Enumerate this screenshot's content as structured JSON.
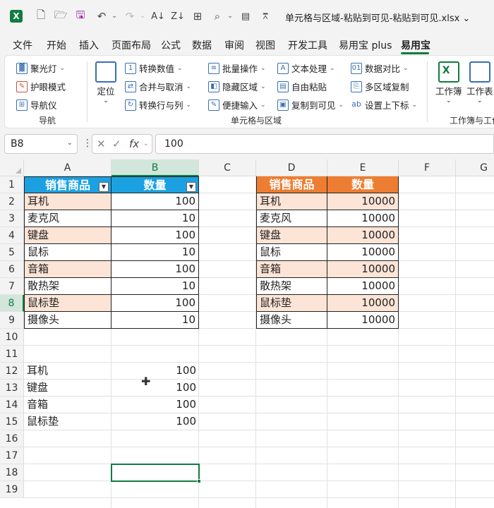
{
  "titlebar": {
    "title": "单元格与区域-粘贴到可见-粘贴到可见.xlsx",
    "excel_icon": "X",
    "icons": [
      "new-file-icon",
      "open-folder-icon",
      "save-icon",
      "undo-icon",
      "redo-icon",
      "sort-asc-icon",
      "sort-desc-icon",
      "borders-icon",
      "search-icon",
      "form-icon",
      "customize-icon"
    ]
  },
  "menu": {
    "tabs": [
      "文件",
      "开始",
      "插入",
      "页面布局",
      "公式",
      "数据",
      "审阅",
      "视图",
      "开发工具",
      "易用宝 plus",
      "易用宝"
    ],
    "active": "易用宝",
    "accent": "#107c41"
  },
  "ribbon": {
    "nav_group": {
      "items": [
        "聚光灯",
        "护眼模式",
        "导航仪"
      ],
      "label": "导航"
    },
    "locate_label": "定位",
    "cell_group": {
      "col1": [
        "转换数值",
        "合并与取消",
        "转换行与列"
      ],
      "col2": [
        "批量操作",
        "隐藏区域",
        "便捷输入"
      ],
      "col3": [
        "文本处理",
        "自由粘贴",
        "复制到可见"
      ],
      "col4": [
        "数据对比",
        "多区域复制",
        "设置上下标"
      ],
      "label": "单元格与区域"
    },
    "workbook_group": {
      "items": [
        "工作簿",
        "工作表"
      ],
      "label": "工作簿与工作"
    }
  },
  "formula_bar": {
    "name_box": "B8",
    "fx_label": "fx",
    "formula": "100"
  },
  "sheet": {
    "columns": [
      "A",
      "B",
      "C",
      "D",
      "E",
      "F",
      "G"
    ],
    "selected_column": "B",
    "rows": [
      "1",
      "2",
      "3",
      "4",
      "5",
      "6",
      "7",
      "8",
      "9",
      "10",
      "11",
      "12",
      "13",
      "14",
      "15",
      "16",
      "17",
      "18",
      "19"
    ],
    "selected_row": "8",
    "table1": {
      "headers": [
        "销售商品",
        "数量"
      ],
      "header_color": "#1ba1e2",
      "rows": [
        [
          "耳机",
          "100"
        ],
        [
          "麦克风",
          "10"
        ],
        [
          "键盘",
          "100"
        ],
        [
          "鼠标",
          "10"
        ],
        [
          "音箱",
          "100"
        ],
        [
          "散热架",
          "10"
        ],
        [
          "鼠标垫",
          "100"
        ],
        [
          "摄像头",
          "10"
        ]
      ]
    },
    "table2": {
      "headers": [
        "销售商品",
        "数量"
      ],
      "header_color": "#ed7d31",
      "rows": [
        [
          "耳机",
          "10000"
        ],
        [
          "麦克风",
          "10000"
        ],
        [
          "键盘",
          "10000"
        ],
        [
          "鼠标",
          "10000"
        ],
        [
          "音箱",
          "10000"
        ],
        [
          "散热架",
          "10000"
        ],
        [
          "鼠标垫",
          "10000"
        ],
        [
          "摄像头",
          "10000"
        ]
      ]
    },
    "list3": [
      [
        "耳机",
        "100"
      ],
      [
        "键盘",
        "100"
      ],
      [
        "音箱",
        "100"
      ],
      [
        "鼠标垫",
        "100"
      ]
    ],
    "active_cell": "B8",
    "stripe_color": "#fce4d6"
  }
}
